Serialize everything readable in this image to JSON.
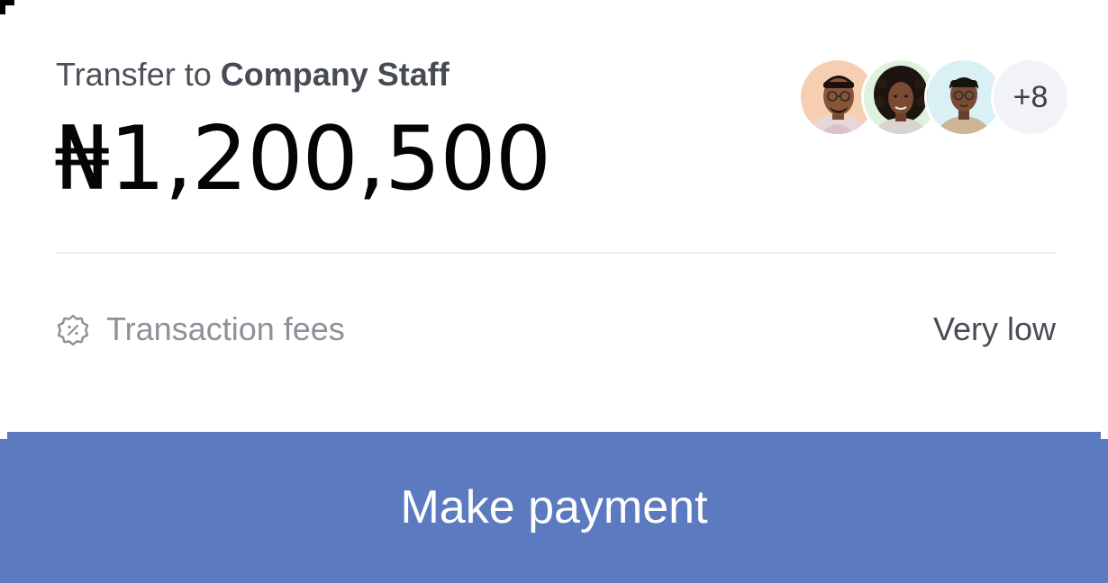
{
  "transfer": {
    "prefix": "Transfer to",
    "recipient": "Company Staff"
  },
  "amount": {
    "display": "₦1,200,500"
  },
  "recipients": {
    "avatars": [
      {
        "name": "avatar-man-glasses"
      },
      {
        "name": "avatar-woman-curly"
      },
      {
        "name": "avatar-woman-glasses"
      }
    ],
    "more_count": "+8"
  },
  "fees": {
    "icon": "discount-badge-icon",
    "label": "Transaction fees",
    "value": "Very low"
  },
  "actions": {
    "pay_label": "Make payment"
  },
  "colors": {
    "button_bg": "#5b7ac0",
    "amount_text": "#050505",
    "muted_text": "#8d9198"
  }
}
